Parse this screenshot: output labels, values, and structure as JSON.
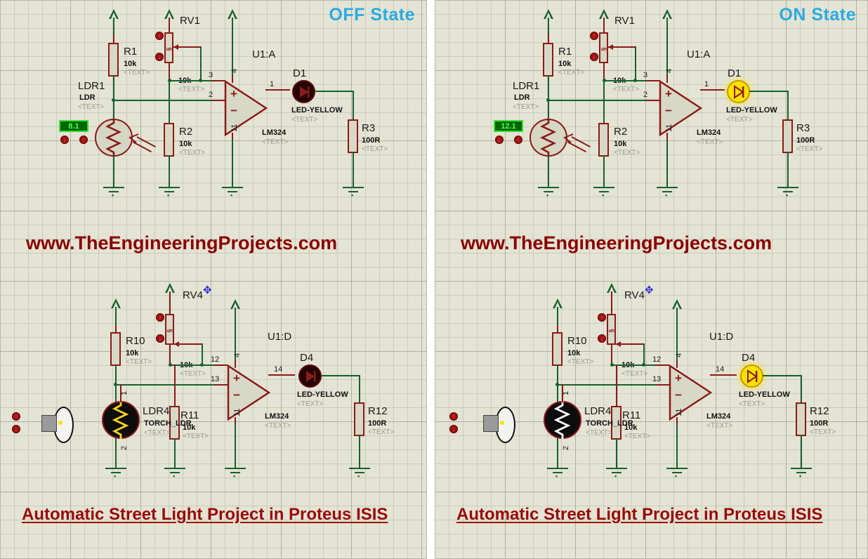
{
  "meta": {
    "bottom_title": "Automatic Street Light Project in Proteus ISIS",
    "watermark": "www.TheEngineeringProjects.com",
    "accent_state_color": "#29ABE2",
    "title_color": "#9B0A0A",
    "watermark_color": "#8B0000",
    "wire_color": "#17612f",
    "component_color": "#8B1A1A"
  },
  "panels": [
    {
      "id": "off",
      "state_label": "OFF State",
      "top_circuit": {
        "ldr": {
          "ref": "LDR1",
          "value": "LDR",
          "text": "<TEXT>",
          "display_value": "8.1",
          "adjust_down": "↓",
          "adjust_up": "↑"
        },
        "r1": {
          "ref": "R1",
          "value": "10k",
          "text": "<TEXT>"
        },
        "r2": {
          "ref": "R2",
          "value": "10k",
          "text": "<TEXT>"
        },
        "r3": {
          "ref": "R3",
          "value": "100R",
          "text": "<TEXT>"
        },
        "pot": {
          "ref": "RV1",
          "value": "10k",
          "text": "<TEXT>",
          "adjust_up": "↑",
          "adjust_down": "↓"
        },
        "opamp": {
          "ref": "U1:A",
          "value": "LM324",
          "text": "<TEXT>",
          "pin_plus": "+",
          "pin_minus": "−",
          "pin_noninv": "3",
          "pin_inv": "2",
          "pin_out": "1",
          "pin_vcc": "4",
          "pin_gnd": "11"
        },
        "led": {
          "ref": "D1",
          "value": "LED-YELLOW",
          "text": "<TEXT>",
          "lit": false
        }
      },
      "bottom_circuit": {
        "ldr": {
          "ref": "LDR4",
          "value": "TORCH_LDR",
          "text": "<TEXT>",
          "pin_top": "1",
          "pin_bottom": "2",
          "zig_color": "#FFD21E"
        },
        "r10": {
          "ref": "R10",
          "value": "10k",
          "text": "<TEXT>"
        },
        "r11": {
          "ref": "R11",
          "value": "10k",
          "text": "<TEXT>"
        },
        "r12": {
          "ref": "R12",
          "value": "100R",
          "text": "<TEXT>"
        },
        "pot": {
          "ref": "RV4",
          "value": "10k",
          "text": "<TEXT>",
          "adjust_up": "↑",
          "adjust_down": "↓"
        },
        "opamp": {
          "ref": "U1:D",
          "value": "LM324",
          "text": "<TEXT>",
          "pin_plus": "+",
          "pin_minus": "−",
          "pin_noninv": "12",
          "pin_inv": "13",
          "pin_out": "14",
          "pin_vcc": "4",
          "pin_gnd": "11"
        },
        "led": {
          "ref": "D4",
          "value": "LED-YELLOW",
          "text": "<TEXT>",
          "lit": false
        },
        "torch": {
          "adjust_up": "↑",
          "adjust_down": "↓"
        }
      },
      "title": "Automatic Street Light Project in Proteus ISIS",
      "watermark": "www.TheEngineeringProjects.com"
    },
    {
      "id": "on",
      "state_label": "ON State",
      "top_circuit": {
        "ldr": {
          "ref": "LDR1",
          "value": "LDR",
          "text": "<TEXT>",
          "display_value": "12.1",
          "adjust_down": "↓",
          "adjust_up": "↑"
        },
        "r1": {
          "ref": "R1",
          "value": "10k",
          "text": "<TEXT>"
        },
        "r2": {
          "ref": "R2",
          "value": "10k",
          "text": "<TEXT>"
        },
        "r3": {
          "ref": "R3",
          "value": "100R",
          "text": "<TEXT>"
        },
        "pot": {
          "ref": "RV1",
          "value": "10k",
          "text": "<TEXT>",
          "adjust_up": "↑",
          "adjust_down": "↓"
        },
        "opamp": {
          "ref": "U1:A",
          "value": "LM324",
          "text": "<TEXT>",
          "pin_plus": "+",
          "pin_minus": "−",
          "pin_noninv": "3",
          "pin_inv": "2",
          "pin_out": "1",
          "pin_vcc": "4",
          "pin_gnd": "11"
        },
        "led": {
          "ref": "D1",
          "value": "LED-YELLOW",
          "text": "<TEXT>",
          "lit": true
        }
      },
      "bottom_circuit": {
        "ldr": {
          "ref": "LDR4",
          "value": "TORCH_LDR",
          "text": "<TEXT>",
          "pin_top": "1",
          "pin_bottom": "2",
          "zig_color": "#FFFFFF"
        },
        "r10": {
          "ref": "R10",
          "value": "10k",
          "text": "<TEXT>"
        },
        "r11": {
          "ref": "R11",
          "value": "10k",
          "text": "<TEXT>"
        },
        "r12": {
          "ref": "R12",
          "value": "100R",
          "text": "<TEXT>"
        },
        "pot": {
          "ref": "RV4",
          "value": "10k",
          "text": "<TEXT>",
          "adjust_up": "↑",
          "adjust_down": "↓"
        },
        "opamp": {
          "ref": "U1:D",
          "value": "LM324",
          "text": "<TEXT>",
          "pin_plus": "+",
          "pin_minus": "−",
          "pin_noninv": "12",
          "pin_inv": "13",
          "pin_out": "14",
          "pin_vcc": "4",
          "pin_gnd": "11"
        },
        "led": {
          "ref": "D4",
          "value": "LED-YELLOW",
          "text": "<TEXT>",
          "lit": true
        },
        "torch": {
          "adjust_up": "↑",
          "adjust_down": "↓"
        }
      },
      "title": "Automatic Street Light Project in Proteus ISIS",
      "watermark": "www.TheEngineeringProjects.com"
    }
  ]
}
